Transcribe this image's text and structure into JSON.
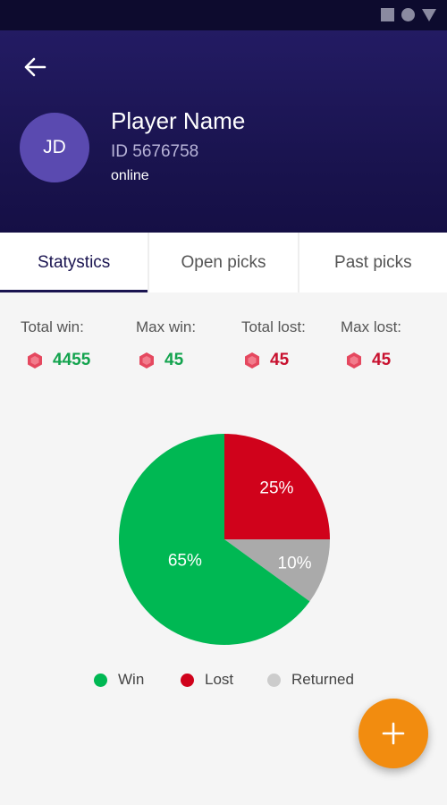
{
  "player": {
    "initials": "JD",
    "name": "Player Name",
    "id": "ID 5676758",
    "status": "online"
  },
  "tabs": [
    {
      "label": "Statystics",
      "active": true
    },
    {
      "label": "Open picks",
      "active": false
    },
    {
      "label": "Past picks",
      "active": false
    }
  ],
  "stats": [
    {
      "label": "Total win:",
      "value": "4455",
      "kind": "win"
    },
    {
      "label": "Max win:",
      "value": "45",
      "kind": "win"
    },
    {
      "label": "Total lost:",
      "value": "45",
      "kind": "lost"
    },
    {
      "label": "Max lost:",
      "value": "45",
      "kind": "lost"
    }
  ],
  "icons": {
    "back": "arrow-left-icon",
    "gem": "ruby-gem-icon",
    "fab": "plus-icon",
    "status_bar": [
      "square-icon",
      "circle-icon",
      "triangle-icon"
    ]
  },
  "colors": {
    "header": "#1a1450",
    "win": "#00b853",
    "lost": "#d0021b",
    "returned": "#aaaaaa",
    "fab": "#f28c0f",
    "gem": "#e5485f"
  },
  "chart_data": {
    "type": "pie",
    "series": [
      {
        "name": "Win",
        "value": 65,
        "label": "65%",
        "color": "#00b853"
      },
      {
        "name": "Lost",
        "value": 25,
        "label": "25%",
        "color": "#d0021b"
      },
      {
        "name": "Returned",
        "value": 10,
        "label": "10%",
        "color": "#aaaaaa"
      }
    ],
    "legend": "bottom"
  },
  "legend": [
    {
      "label": "Win",
      "color": "#00b853"
    },
    {
      "label": "Lost",
      "color": "#d0021b"
    },
    {
      "label": "Returned",
      "color": "#cccccc"
    }
  ]
}
